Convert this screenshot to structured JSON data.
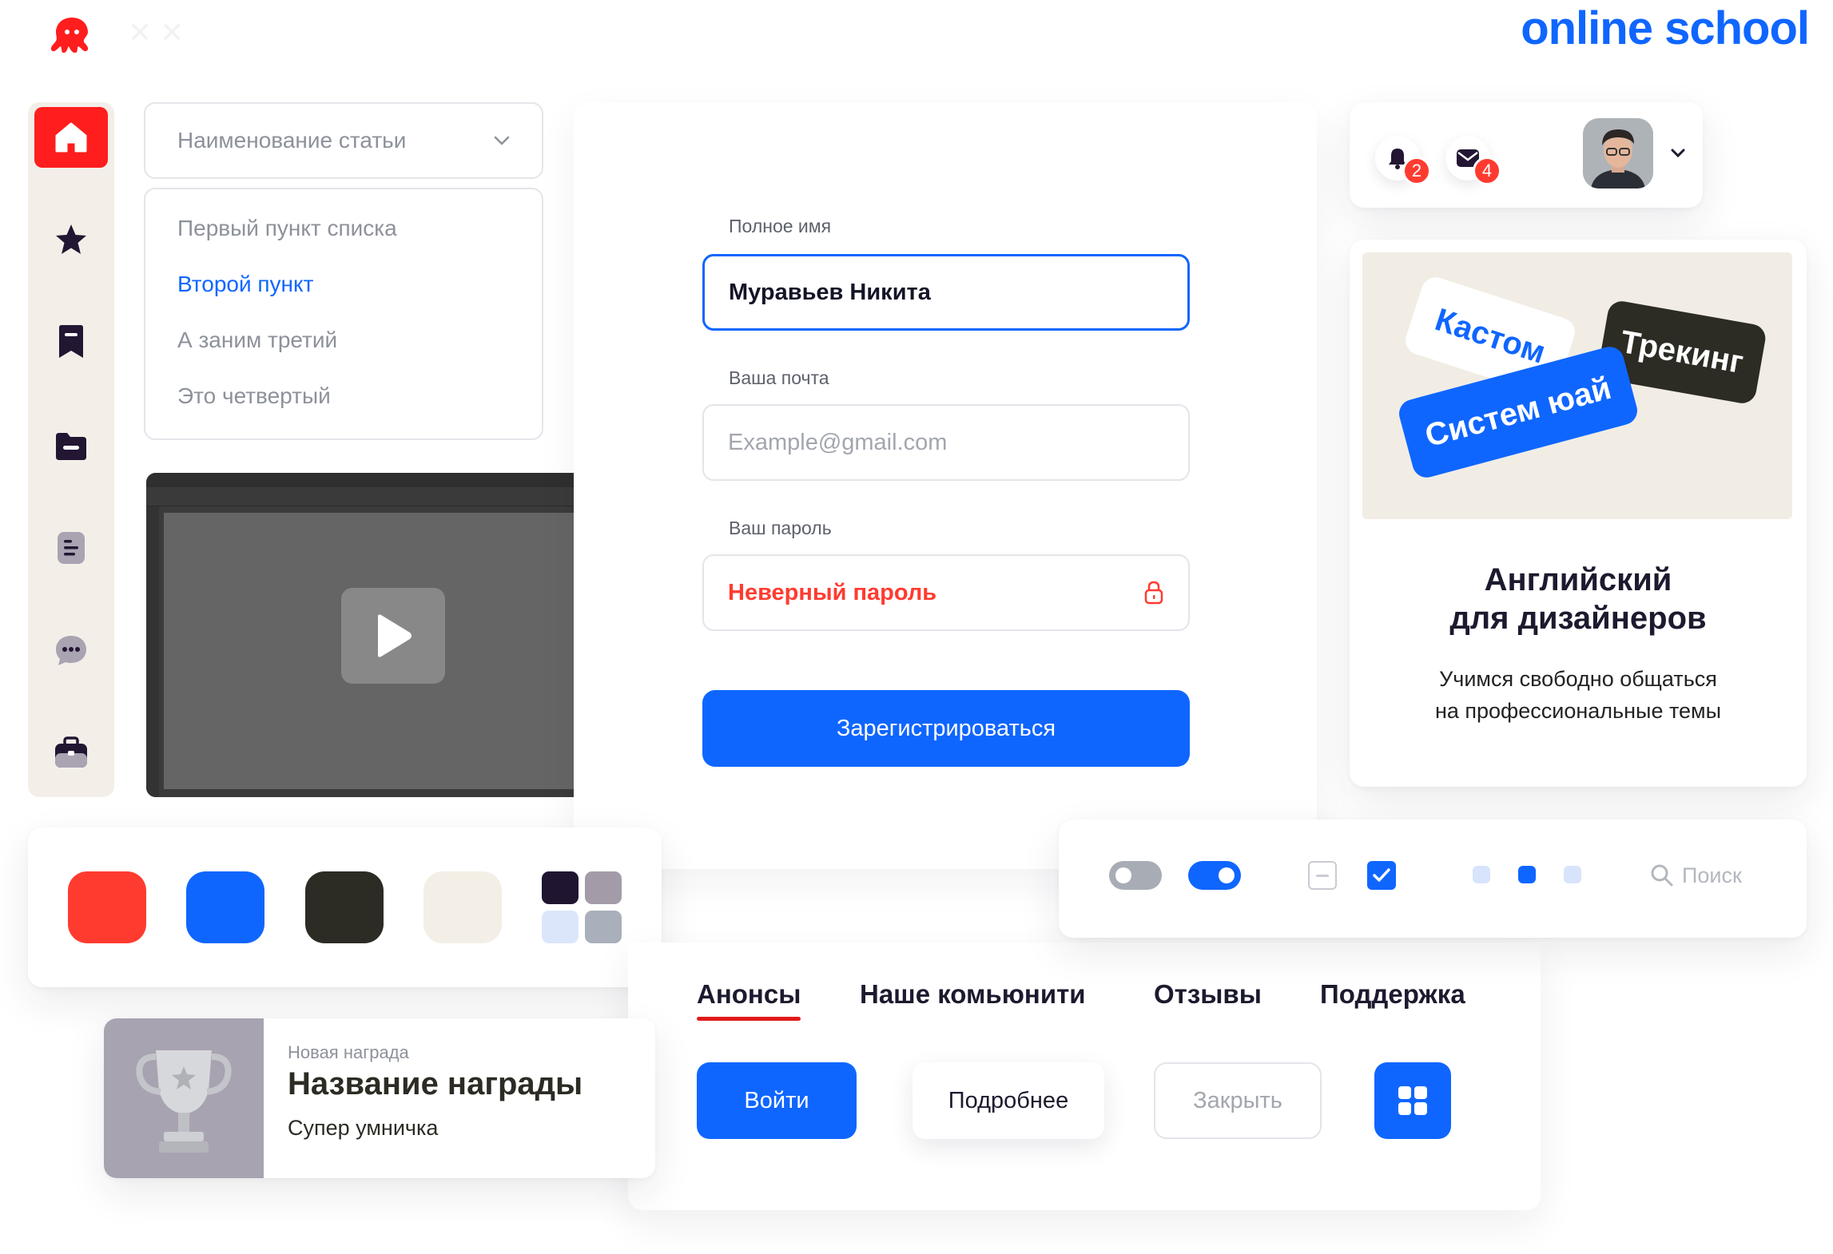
{
  "brand": {
    "name": "online school",
    "logo_icon": "octopus-icon",
    "color": "#0f66ff"
  },
  "sidebar": {
    "items": [
      {
        "name": "home",
        "icon": "home-icon",
        "active": true
      },
      {
        "name": "favorites",
        "icon": "star-icon",
        "active": false
      },
      {
        "name": "bookmarks",
        "icon": "bookmark-icon",
        "active": false
      },
      {
        "name": "folders",
        "icon": "folder-icon",
        "active": false
      },
      {
        "name": "documents",
        "icon": "document-icon",
        "active": false
      },
      {
        "name": "chat",
        "icon": "chat-icon",
        "active": false
      },
      {
        "name": "portfolio",
        "icon": "briefcase-icon",
        "active": false
      }
    ]
  },
  "dropdown": {
    "placeholder": "Наименование статьи",
    "options": [
      "Первый пункт списка",
      "Второй пункт",
      "А заним третий",
      "Это четвертый"
    ],
    "selected_index": 1
  },
  "video": {
    "play_icon": "play-icon"
  },
  "form": {
    "full_name_label": "Полное имя",
    "full_name_value": "Муравьев Никита",
    "email_label": "Ваша почта",
    "email_placeholder": "Example@gmail.com",
    "password_label": "Ваш пароль",
    "password_error": "Неверный пароль",
    "submit_label": "Зарегистрироваться"
  },
  "notifications": {
    "bell_count": "2",
    "mail_count": "4"
  },
  "course": {
    "tags": [
      "Кастом",
      "Трекинг",
      "Систем юай"
    ],
    "title_line1": "Английский",
    "title_line2": "для дизайнеров",
    "desc_line1": "Учимся свободно общаться",
    "desc_line2": "на профессиональные темы"
  },
  "palette": {
    "colors": [
      "#ff3b30",
      "#0f66ff",
      "#2c2b24",
      "#f3efe6"
    ],
    "mini": [
      "#1f1530",
      "#a39ca8",
      "#dbe6fb",
      "#a9b0bc"
    ]
  },
  "controls": {
    "search_placeholder": "Поиск"
  },
  "tabs": [
    "Анонсы",
    "Наше комьюнити",
    "Отзывы",
    "Поддержка"
  ],
  "buttons": {
    "login": "Войти",
    "more": "Подробнее",
    "close": "Закрыть"
  },
  "award": {
    "caption": "Новая награда",
    "title": "Название награды",
    "subtitle": "Супер умничка"
  }
}
